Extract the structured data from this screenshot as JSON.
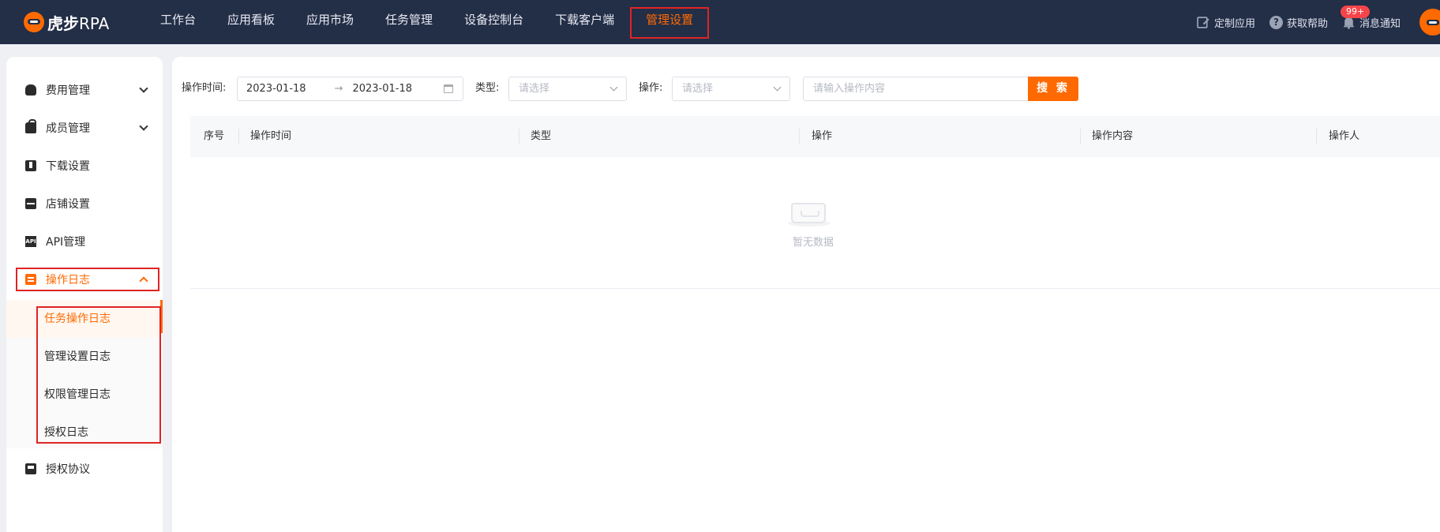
{
  "app": {
    "logo_cn": "虎步",
    "logo_en": "RPA"
  },
  "nav": {
    "items": [
      "工作台",
      "应用看板",
      "应用市场",
      "任务管理",
      "设备控制台",
      "下载客户端",
      "管理设置"
    ],
    "active": "管理设置"
  },
  "top_right": {
    "custom_app": "定制应用",
    "get_help": "获取帮助",
    "notifications": "消息通知",
    "badge": "99+"
  },
  "sidebar": {
    "items": [
      {
        "label": "费用管理",
        "icon": "money-bag-icon",
        "has_caret": true
      },
      {
        "label": "成员管理",
        "icon": "briefcase-icon",
        "has_caret": true
      },
      {
        "label": "下载设置",
        "icon": "download-icon",
        "has_caret": false
      },
      {
        "label": "店铺设置",
        "icon": "store-icon",
        "has_caret": false
      },
      {
        "label": "API管理",
        "icon": "api-icon",
        "has_caret": false
      },
      {
        "label": "操作日志",
        "icon": "log-icon",
        "has_caret": true,
        "open": true
      },
      {
        "label": "授权协议",
        "icon": "save-icon",
        "has_caret": false
      }
    ],
    "sub_items": [
      "任务操作日志",
      "管理设置日志",
      "权限管理日志",
      "授权日志"
    ],
    "active_sub": "任务操作日志"
  },
  "filters": {
    "time_label": "操作时间:",
    "date_start": "2023-01-18",
    "date_sep": "→",
    "date_end": "2023-01-18",
    "type_label": "类型:",
    "type_placeholder": "请选择",
    "op_label": "操作:",
    "op_placeholder": "请选择",
    "content_placeholder": "请输入操作内容",
    "search_button": "搜 索"
  },
  "table": {
    "columns": [
      "序号",
      "操作时间",
      "类型",
      "操作",
      "操作内容",
      "操作人"
    ],
    "rows": [],
    "empty_text": "暂无数据"
  },
  "colors": {
    "topbar": "#232e47",
    "accent": "#ff6a00",
    "highlight_box": "#e02424"
  }
}
